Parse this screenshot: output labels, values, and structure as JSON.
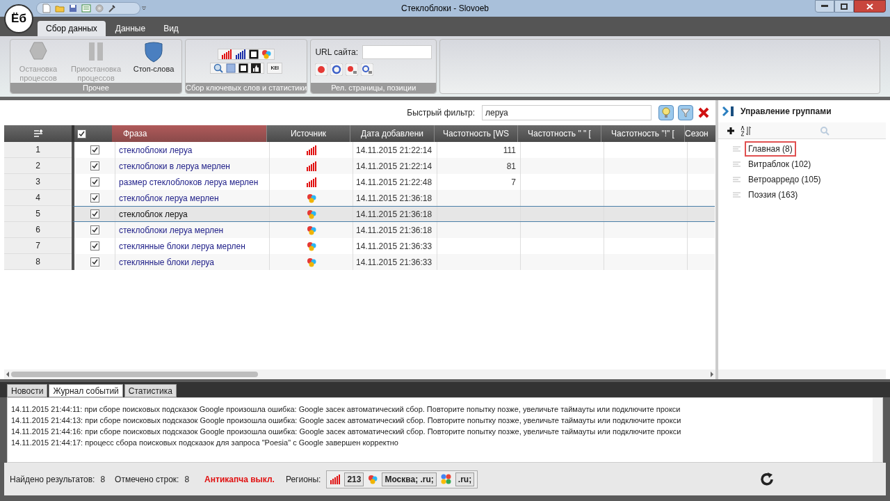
{
  "window": {
    "title": "Стеклоблоки - Slovoeb",
    "logo": "Ёб"
  },
  "ribbon_tabs": [
    {
      "label": "Сбор данных",
      "selected": true
    },
    {
      "label": "Данные",
      "selected": false
    },
    {
      "label": "Вид",
      "selected": false
    }
  ],
  "ribbon": {
    "other_group": {
      "title": "Прочее",
      "buttons": [
        {
          "label": "Остановка процессов",
          "kind": "stop",
          "disabled": true
        },
        {
          "label": "Приостановка процессов",
          "kind": "pause",
          "disabled": true
        },
        {
          "label": "Стоп-слова",
          "kind": "shield",
          "disabled": false
        }
      ]
    },
    "keywords_group": {
      "title": "Сбор ключевых слов и статистики",
      "kei": "KEI"
    },
    "relevant_group": {
      "title": "Рел. страницы, позиции",
      "url_label": "URL сайта:"
    }
  },
  "filter": {
    "label": "Быстрый фильтр:",
    "value": "леруа"
  },
  "table": {
    "columns": [
      "Фраза",
      "Источник",
      "Дата добавлени",
      "Частотность [WS",
      "Частотность \" \" [",
      "Частотность \"!\" [",
      "Сезон"
    ],
    "all_checked": true,
    "rows": [
      {
        "num": "1",
        "checked": true,
        "phrase": "стеклоблоки леруа",
        "kind": "wordstat",
        "date": "14.11.2015 21:22:14",
        "freq": "111",
        "selected": false
      },
      {
        "num": "2",
        "checked": true,
        "phrase": "стеклоблоки в леруа мерлен",
        "kind": "wordstat",
        "date": "14.11.2015 21:22:14",
        "freq": "81",
        "selected": false
      },
      {
        "num": "3",
        "checked": true,
        "phrase": "размер стеклоблоков леруа мерлен",
        "kind": "wordstat",
        "date": "14.11.2015 21:22:48",
        "freq": "7",
        "selected": false
      },
      {
        "num": "4",
        "checked": true,
        "phrase": "стеклоблок леруа мерлен",
        "kind": "yandex",
        "date": "14.11.2015 21:36:18",
        "selected": false
      },
      {
        "num": "5",
        "checked": true,
        "phrase": "стеклоблок леруа",
        "kind": "yandex",
        "date": "14.11.2015 21:36:18",
        "selected": true
      },
      {
        "num": "6",
        "checked": true,
        "phrase": "стеклоблоки леруа мерлен",
        "kind": "yandex",
        "date": "14.11.2015 21:36:18",
        "selected": false
      },
      {
        "num": "7",
        "checked": true,
        "phrase": "стеклянные блоки леруа мерлен",
        "kind": "yandex",
        "date": "14.11.2015 21:36:33",
        "selected": false
      },
      {
        "num": "8",
        "checked": true,
        "phrase": "стеклянные блоки леруа",
        "kind": "yandex",
        "date": "14.11.2015 21:36:33",
        "selected": false
      }
    ]
  },
  "groups": {
    "title": "Управление группами",
    "items": [
      {
        "label": "Главная (8)",
        "selected": true
      },
      {
        "label": "Витраблок (102)",
        "selected": false
      },
      {
        "label": "Ветроарредо (105)",
        "selected": false
      },
      {
        "label": "Поэзия (163)",
        "selected": false
      }
    ]
  },
  "bottom_tabs": [
    {
      "label": "Новости",
      "selected": false
    },
    {
      "label": "Журнал событий",
      "selected": true
    },
    {
      "label": "Статистика",
      "selected": false
    }
  ],
  "log": [
    "14.11.2015 21:44:11: при сборе поисковых подсказок Google произошла ошибка: Google засек автоматический сбор. Повторите попытку позже, увеличьте таймауты или подключите прокси",
    "14.11.2015 21:44:13: при сборе поисковых подсказок Google произошла ошибка: Google засек автоматический сбор. Повторите попытку позже, увеличьте таймауты или подключите прокси",
    "14.11.2015 21:44:16: при сборе поисковых подсказок Google произошла ошибка: Google засек автоматический сбор. Повторите попытку позже, увеличьте таймауты или подключите прокси",
    "14.11.2015 21:44:17: процесс сбора поисковых подсказок для запроса \"Poesia\" с Google завершен корректно"
  ],
  "status_bar": {
    "found_label": "Найдено результатов:",
    "found": "8",
    "marked_label": "Отмечено строк:",
    "marked": "8",
    "anticaptcha": "Антикапча выкл.",
    "regions_label": "Регионы:",
    "regions": [
      {
        "kind": "wordstat",
        "value": "213"
      },
      {
        "kind": "yandex",
        "value": "Москва; .ru;"
      },
      {
        "kind": "google",
        "value": ".ru;"
      }
    ]
  }
}
